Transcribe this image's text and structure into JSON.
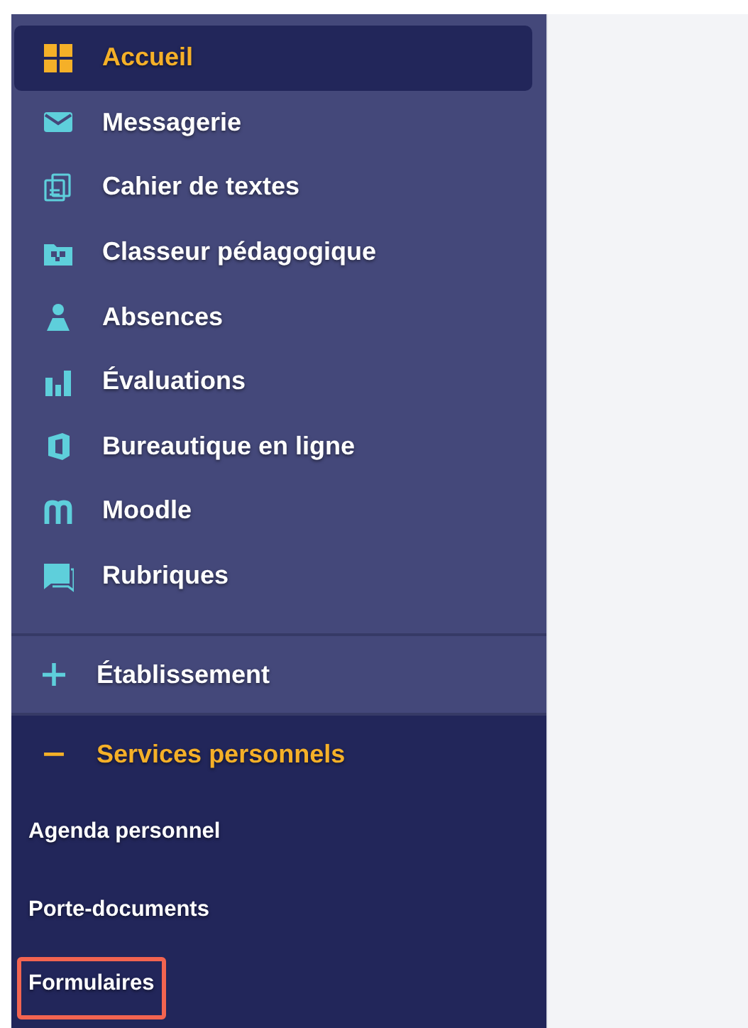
{
  "sidebar": {
    "items": [
      {
        "label": "Accueil",
        "selected": true
      },
      {
        "label": "Messagerie",
        "selected": false
      },
      {
        "label": "Cahier de textes",
        "selected": false
      },
      {
        "label": "Classeur pédagogique",
        "selected": false
      },
      {
        "label": "Absences",
        "selected": false
      },
      {
        "label": "Évaluations",
        "selected": false
      },
      {
        "label": "Bureautique en ligne",
        "selected": false
      },
      {
        "label": "Moodle",
        "selected": false
      },
      {
        "label": "Rubriques",
        "selected": false
      }
    ],
    "sections": [
      {
        "label": "Établissement",
        "expanded": false
      },
      {
        "label": "Services personnels",
        "expanded": true,
        "children": [
          {
            "label": "Agenda personnel",
            "highlighted": false
          },
          {
            "label": "Porte-documents",
            "highlighted": false
          },
          {
            "label": "Formulaires",
            "highlighted": true
          }
        ]
      }
    ]
  }
}
